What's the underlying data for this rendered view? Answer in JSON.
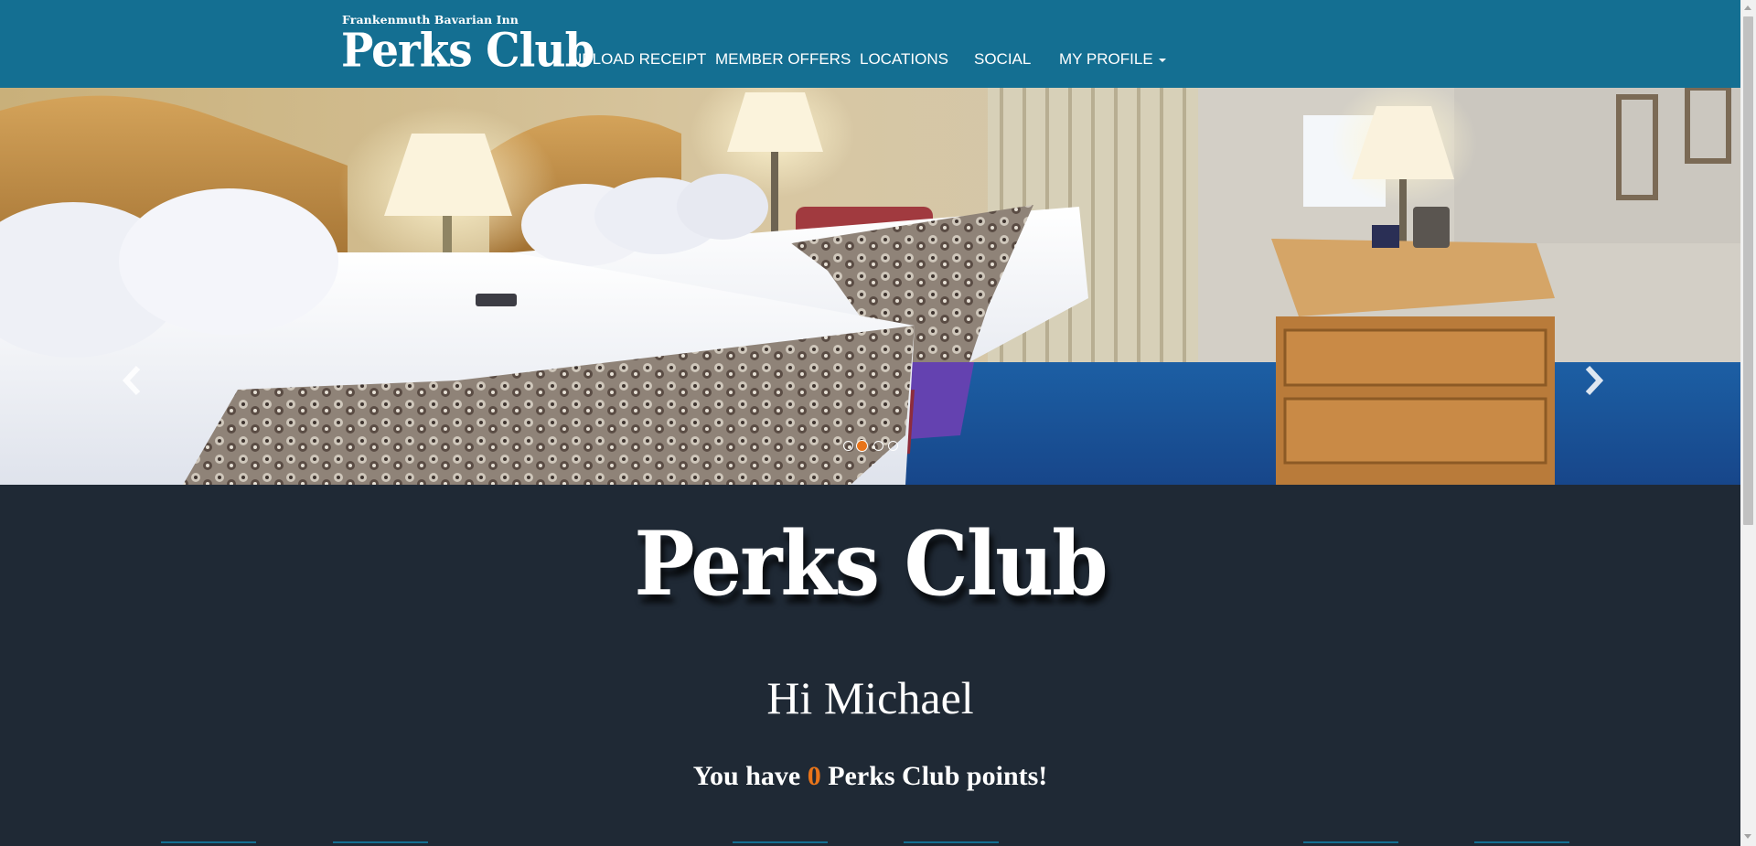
{
  "brand": {
    "subtitle": "Frankenmuth Bavarian Inn",
    "name": "Perks Club"
  },
  "nav": {
    "items": [
      {
        "label": "UPLOAD RECEIPT"
      },
      {
        "label": "MEMBER OFFERS"
      },
      {
        "label": "LOCATIONS"
      },
      {
        "label": "SOCIAL"
      },
      {
        "label": "MY PROFILE",
        "has_dropdown": true
      }
    ]
  },
  "carousel": {
    "slide_count": 4,
    "active_index": 1,
    "prev_icon": "chevron-left-icon",
    "next_icon": "chevron-right-icon"
  },
  "content": {
    "logo_text": "Perks Club",
    "greeting": "Hi Michael",
    "points_prefix": "You have",
    "points_value": "0",
    "points_suffix": "Perks Club points!"
  },
  "colors": {
    "navbar": "#146f92",
    "page_background": "#1f2935",
    "accent": "#e8741a"
  }
}
